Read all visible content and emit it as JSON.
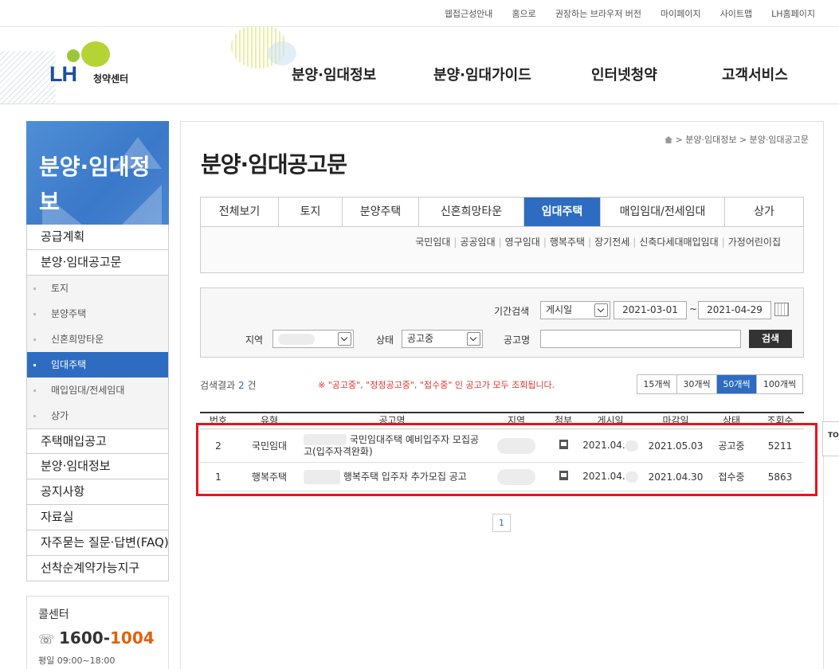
{
  "util_links": [
    "웹접근성안내",
    "홈으로",
    "권장하는 브라우저 버전",
    "마이페이지",
    "사이트맵",
    "LH홈페이지"
  ],
  "logo": {
    "brand": "LH",
    "sub": "청약센터"
  },
  "gnb": [
    "분양·임대정보",
    "분양·임대가이드",
    "인터넷청약",
    "고객서비스"
  ],
  "sidebar": {
    "title": "분양·임대정보",
    "menu_top": [
      "공급계획",
      "분양·임대공고문"
    ],
    "sub_items": [
      "토지",
      "분양주택",
      "신혼희망타운",
      "임대주택",
      "매입임대/전세임대",
      "상가"
    ],
    "active_sub": "임대주택",
    "menu_bottom": [
      "주택매입공고",
      "분양·임대정보",
      "공지사항",
      "자료실",
      "자주묻는 질문·답변(FAQ)",
      "선착순계약가능지구"
    ]
  },
  "callcenter": {
    "title": "콜센터",
    "num_a": "1600",
    "sep": "-",
    "num_b": "1004",
    "hours": "평일 09:00~18:00"
  },
  "breadcrumb": [
    "분양·임대정보",
    "분양·임대공고문"
  ],
  "page_title": "분양·임대공고문",
  "tabs": [
    "전체보기",
    "토지",
    "분양주택",
    "신혼희망타운",
    "임대주택",
    "매입임대/전세임대",
    "상가"
  ],
  "active_tab": "임대주택",
  "subtabs": [
    "국민임대",
    "공공임대",
    "영구임대",
    "행복주택",
    "장기전세",
    "신축다세대매입임대",
    "가정어린이집"
  ],
  "search": {
    "period_label": "기간검색",
    "period_type": "게시일",
    "date_from": "2021-03-01",
    "tilde": "~",
    "date_to": "2021-04-29",
    "region_label": "지역",
    "status_label": "상태",
    "status_value": "공고중",
    "name_label": "공고명",
    "button": "검색"
  },
  "result": {
    "prefix": "검색결과",
    "count": "2",
    "suffix": "건"
  },
  "notice": "※ \"공고중\", \"정정공고중\", \"접수중\" 인 공고가 모두 조회됩니다.",
  "page_sizes": [
    "15개씩",
    "30개씩",
    "50개씩",
    "100개씩"
  ],
  "active_page_size": "50개씩",
  "table": {
    "headers": [
      "번호",
      "유형",
      "공고명",
      "지역",
      "첨부",
      "게시일",
      "마감일",
      "상태",
      "조회수"
    ],
    "rows": [
      {
        "no": "2",
        "type": "국민임대",
        "title": "국민임대주택 예비입주자 모집공고(입주자격완화)",
        "posted": "2021.04.",
        "deadline": "2021.05.03",
        "status": "공고중",
        "views": "5211"
      },
      {
        "no": "1",
        "type": "행복주택",
        "title": "행복주택 입주자 추가모집 공고",
        "posted": "2021.04.",
        "deadline": "2021.04.30",
        "status": "접수중",
        "views": "5863"
      }
    ]
  },
  "pagination": [
    "1"
  ],
  "top_button": "TOP"
}
